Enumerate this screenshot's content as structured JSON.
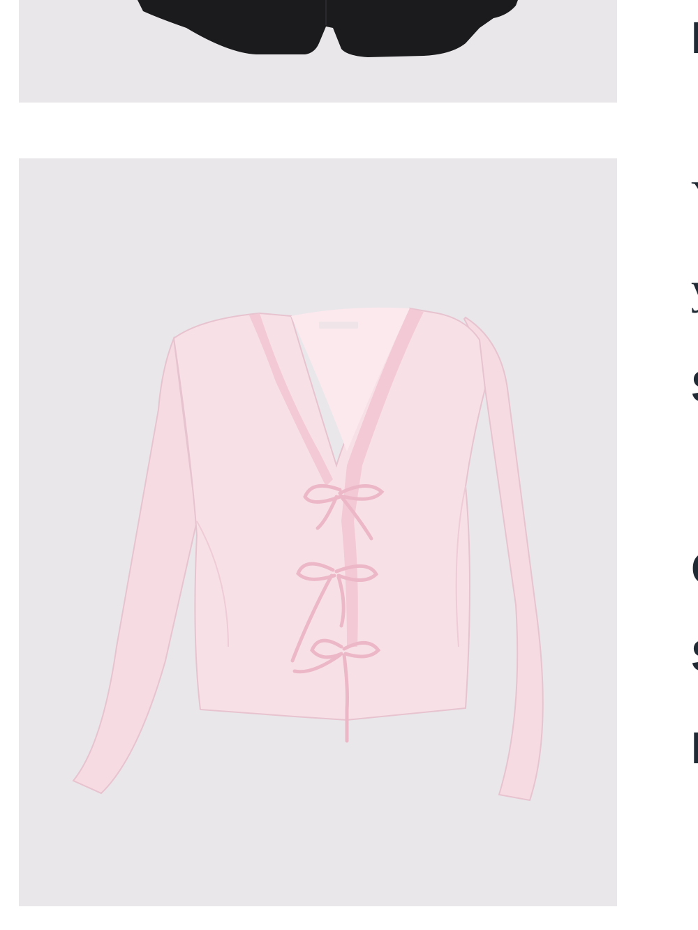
{
  "products": [
    {
      "image": "black-shorts",
      "colors": {
        "garment": "#1b1b1d",
        "background": "#e9e7ea"
      }
    },
    {
      "image": "pink-lace-tie-front-top",
      "colors": {
        "garment": "#f6dbe3",
        "ties": "#ecb8c8",
        "lace": "#f2c6d3",
        "background": "#e9e7ea"
      }
    }
  ],
  "side_text": {
    "line1": "I",
    "line2": "Y",
    "line3": "y",
    "line4": "S",
    "line5": "C",
    "line6": "S",
    "line7": "I"
  }
}
